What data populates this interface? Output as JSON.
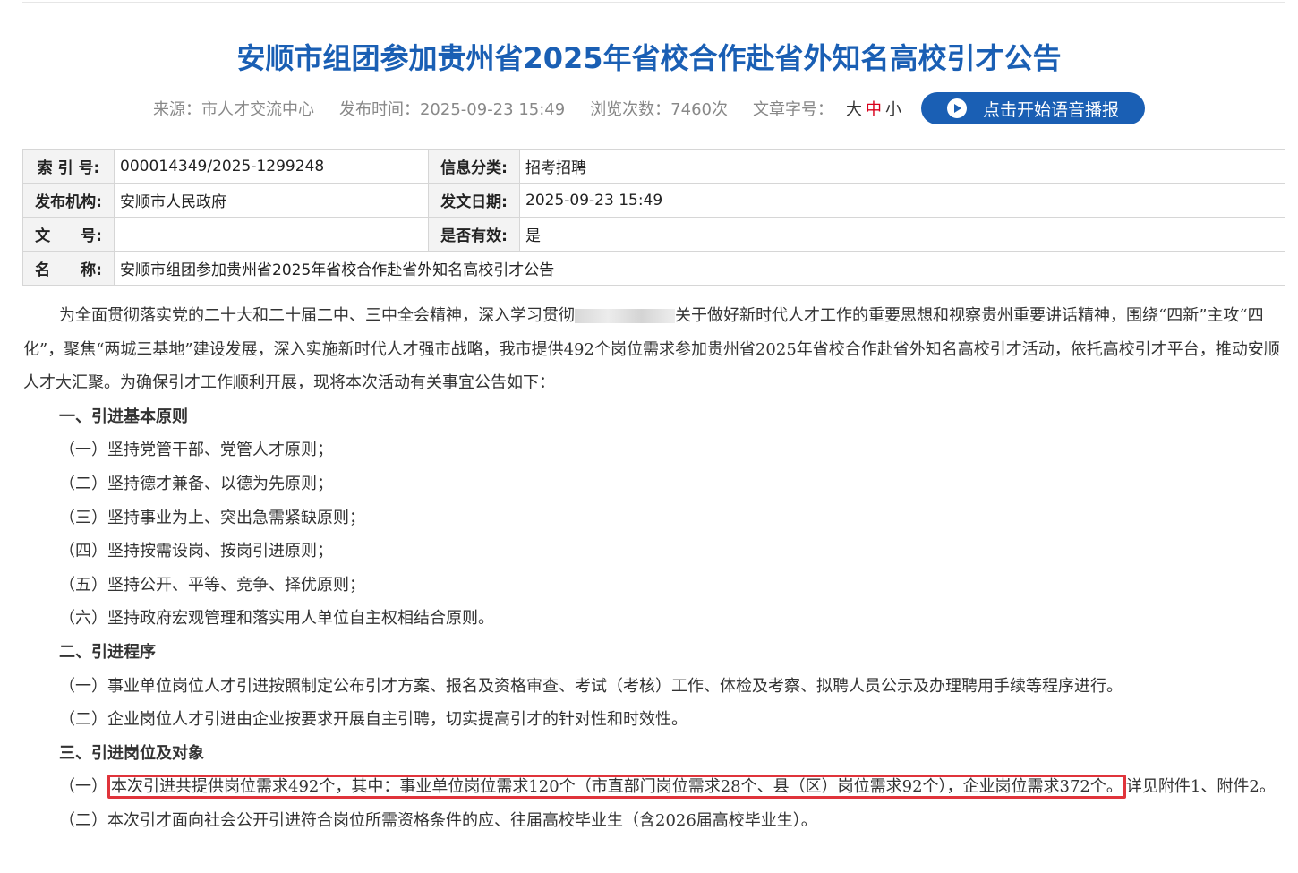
{
  "article": {
    "title": "安顺市组团参加贵州省2025年省校合作赴省外知名高校引才公告",
    "meta": {
      "source": "来源：市人才交流中心",
      "publish_time": "发布时间：2025-09-23 15:49",
      "views": "浏览次数：7460次",
      "font_size_label": "文章字号：",
      "font_large": "大",
      "font_medium": "中",
      "font_small": "小",
      "tts_button": "点击开始语音播报"
    },
    "info_table": {
      "index_label": "索 引 号:",
      "index_value": "000014349/2025-1299248",
      "category_label": "信息分类:",
      "category_value": "招考招聘",
      "publisher_label": "发布机构:",
      "publisher_value": "安顺市人民政府",
      "date_label": "发文日期:",
      "date_value": "2025-09-23 15:49",
      "doc_no_label": "文　　号:",
      "doc_no_value": "",
      "valid_label": "是否有效:",
      "valid_value": "是",
      "name_label": "名　　称:",
      "name_value": "安顺市组团参加贵州省2025年省校合作赴省外知名高校引才公告"
    },
    "body": {
      "intro_a": "为全面贯彻落实党的二十大和二十届二中、三中全会精神，深入学习贯彻",
      "intro_b": "关于做好新时代人才工作的重要思想和视察贵州重要讲话精神，围绕“四新”主攻“四化”，聚焦“两城三基地”建设发展，深入实施新时代人才强市战略，我市提供492个岗位需求参加贵州省2025年省校合作赴省外知名高校引才活动，依托高校引才平台，推动安顺人才大汇聚。为确保引才工作顺利开展，现将本次活动有关事宜公告如下：",
      "section1_title": "一、引进基本原则",
      "section1_items": [
        "（一）坚持党管干部、党管人才原则；",
        "（二）坚持德才兼备、以德为先原则；",
        "（三）坚持事业为上、突出急需紧缺原则；",
        "（四）坚持按需设岗、按岗引进原则；",
        "（五）坚持公开、平等、竞争、择优原则；",
        "（六）坚持政府宏观管理和落实用人单位自主权相结合原则。"
      ],
      "section2_title": "二、引进程序",
      "section2_items": [
        "（一）事业单位岗位人才引进按照制定公布引才方案、报名及资格审查、考试（考核）工作、体检及考察、拟聘人员公示及办理聘用手续等程序进行。",
        "（二）企业岗位人才引进由企业按要求开展自主引聘，切实提高引才的针对性和时效性。"
      ],
      "section3_title": "三、引进岗位及对象",
      "section3_item1_prefix": "（一）",
      "section3_item1_highlight": "本次引进共提供岗位需求492个，其中：事业单位岗位需求120个（市直部门岗位需求28个、县（区）岗位需求92个），企业岗位需求372个。",
      "section3_item1_suffix": "详见附件1、附件2。",
      "section3_item2": "（二）本次引才面向社会公开引进符合岗位所需资格条件的应、往届高校毕业生（含2026届高校毕业生）。"
    }
  }
}
